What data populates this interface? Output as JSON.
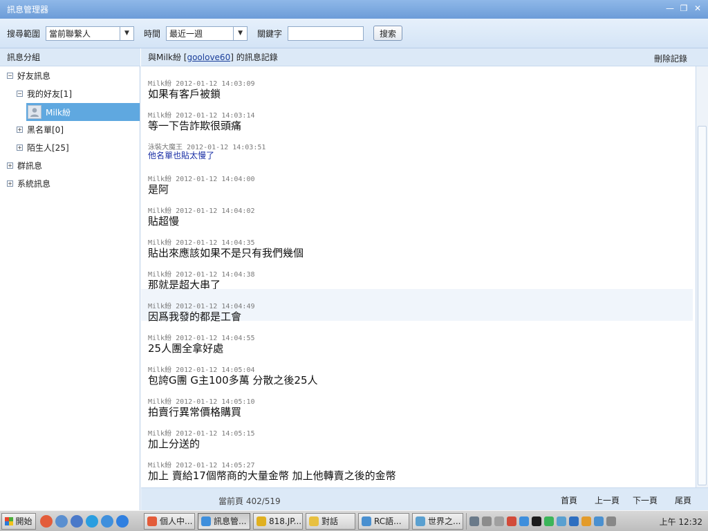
{
  "window": {
    "title": "訊息管理器",
    "controls": {
      "minimize": "—",
      "restore": "❐",
      "close": "✕"
    }
  },
  "toolbar": {
    "scope_label": "搜尋範圍",
    "scope_value": "當前聯繫人",
    "time_label": "時間",
    "time_value": "最近一週",
    "keyword_label": "關鍵字",
    "keyword_value": "",
    "search_label": "搜索"
  },
  "left": {
    "header": "訊息分組",
    "tree": {
      "friends": "好友訊息",
      "my_friends": "我的好友[1]",
      "contact": "Milk紛",
      "blacklist": "黑名單[0]",
      "strangers": "陌生人[25]",
      "groups": "群訊息",
      "system": "系統訊息",
      "expanded": "⊟",
      "collapsed": "⊞"
    }
  },
  "right": {
    "header_prefix": "與Milk紛 [",
    "header_link": "goolove60",
    "header_suffix": "] 的訊息記錄",
    "delete_label": "刪除記錄"
  },
  "messages": [
    {
      "sender": "Milk紛",
      "time": "2012-01-12 14:03:09",
      "text": "如果有客戶被鎖"
    },
    {
      "sender": "Milk紛",
      "time": "2012-01-12 14:03:14",
      "text": "等一下告詐欺很頭痛"
    },
    {
      "sender": "泳裝大魔王",
      "time": "2012-01-12 14:03:51",
      "text": "他名單也貼太慢了"
    },
    {
      "sender": "Milk紛",
      "time": "2012-01-12 14:04:00",
      "text": "是阿"
    },
    {
      "sender": "Milk紛",
      "time": "2012-01-12 14:04:02",
      "text": "貼超慢"
    },
    {
      "sender": "Milk紛",
      "time": "2012-01-12 14:04:35",
      "text": "貼出來應該如果不是只有我們幾個"
    },
    {
      "sender": "Milk紛",
      "time": "2012-01-12 14:04:38",
      "text": "那就是超大串了"
    },
    {
      "sender": "Milk紛",
      "time": "2012-01-12 14:04:49",
      "text": "因爲我發的都是工會"
    },
    {
      "sender": "Milk紛",
      "time": "2012-01-12 14:04:55",
      "text": "25人團全拿好處"
    },
    {
      "sender": "Milk紛",
      "time": "2012-01-12 14:05:04",
      "text": "包誇G團 G主100多萬 分散之後25人"
    },
    {
      "sender": "Milk紛",
      "time": "2012-01-12 14:05:10",
      "text": "拍賣行異常價格購買"
    },
    {
      "sender": "Milk紛",
      "time": "2012-01-12 14:05:15",
      "text": "加上分送的"
    },
    {
      "sender": "Milk紛",
      "time": "2012-01-12 14:05:27",
      "text": "加上 賣給17個幣商的大量金幣 加上他轉賣之後的金幣"
    }
  ],
  "footer": {
    "page_label": "當前頁 402/519",
    "first": "首頁",
    "prev": "上一頁",
    "next": "下一頁",
    "last": "尾頁"
  },
  "taskbar": {
    "start": "開始",
    "tasks": [
      "個人中...",
      "訊息管...",
      "818.JP...",
      "對話",
      "RC語...",
      "世界之..."
    ],
    "clock": "上午 12:32"
  },
  "colors": {
    "title_bar": "#7aa7df",
    "selected": "#5fa8e0",
    "other_sender_text": "#1a2fa5"
  }
}
